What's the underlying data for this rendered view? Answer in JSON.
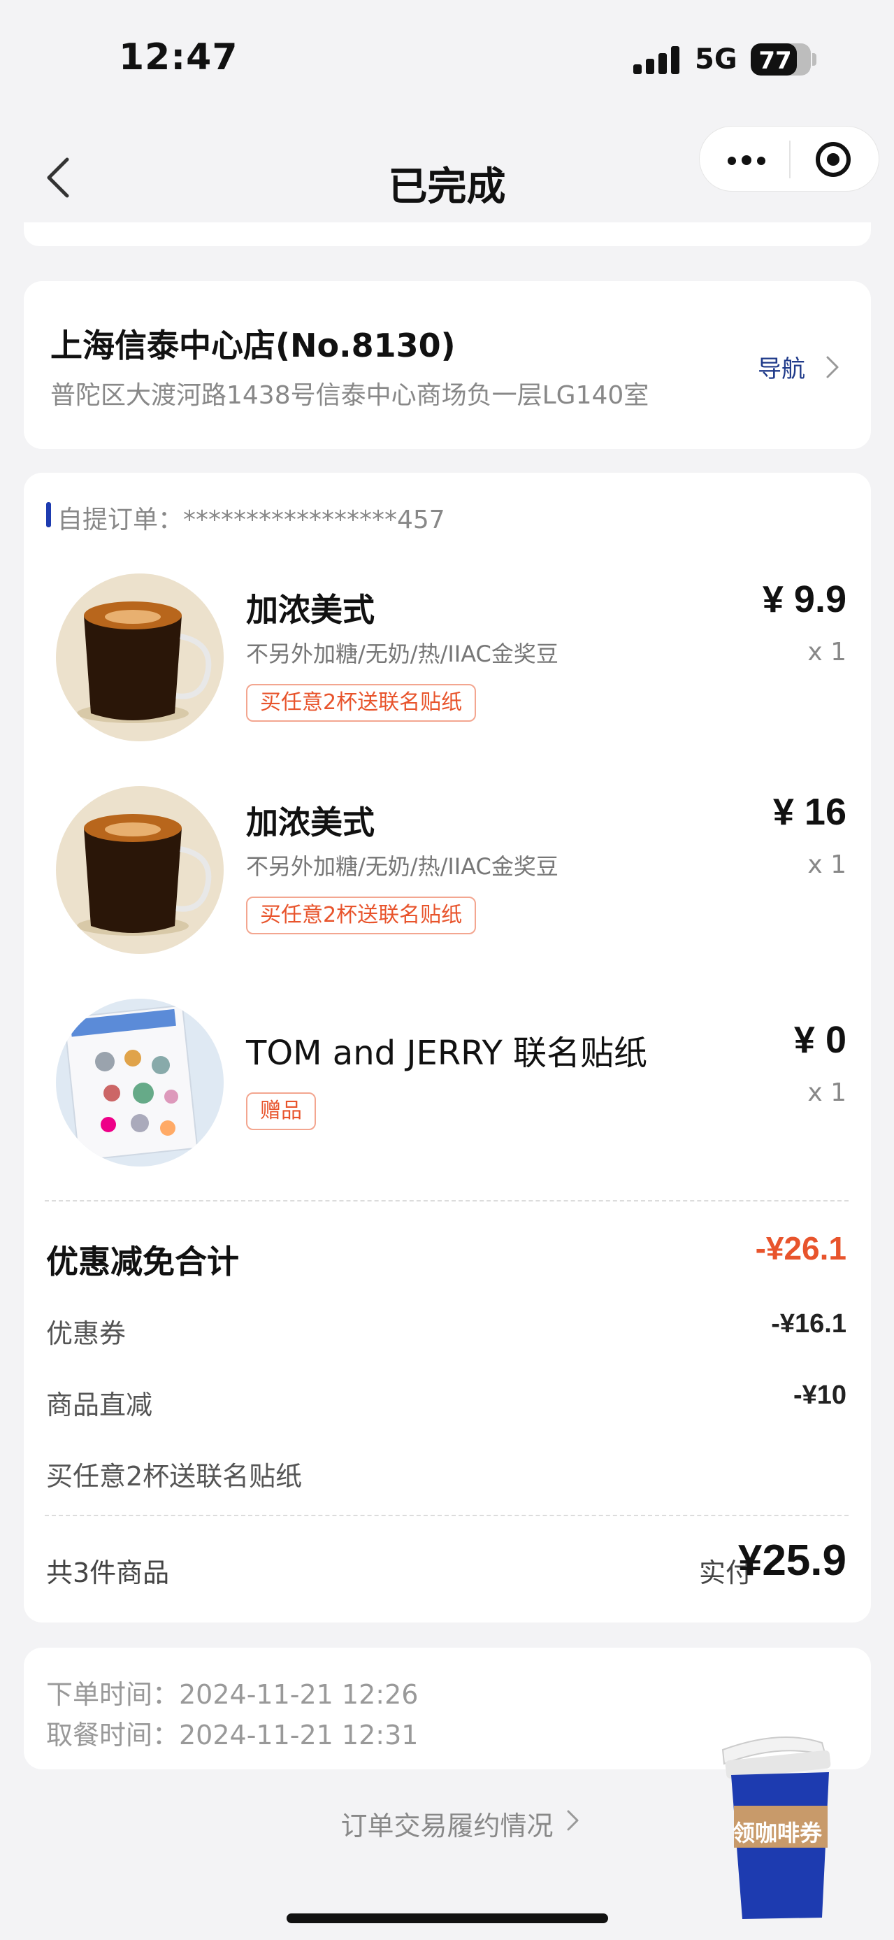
{
  "status_bar": {
    "time": "12:47",
    "network": "5G",
    "battery": "77",
    "battery_level": 0.77
  },
  "nav": {
    "title": "已完成"
  },
  "store": {
    "name": "上海信泰中心店(No.8130)",
    "address": "普陀区大渡河路1438号信泰中心商场负一层LG140室",
    "nav_label": "导航"
  },
  "order": {
    "label": "自提订单：*****************457",
    "items": [
      {
        "name": "加浓美式",
        "spec": "不另外加糖/无奶/热/IIAC金奖豆",
        "tag": "买任意2杯送联名贴纸",
        "price": "¥ 9.9",
        "qty": "x 1"
      },
      {
        "name": "加浓美式",
        "spec": "不另外加糖/无奶/热/IIAC金奖豆",
        "tag": "买任意2杯送联名贴纸",
        "price": "¥ 16",
        "qty": "x 1"
      },
      {
        "name": "TOM and JERRY 联名贴纸",
        "spec": "",
        "tag": "赠品",
        "price": "¥ 0",
        "qty": "x 1"
      }
    ],
    "discount": {
      "title": "优惠减免合计",
      "total": "-¥26.1",
      "rows": [
        {
          "label": "优惠券",
          "value": "-¥16.1"
        },
        {
          "label": "商品直减",
          "value": "-¥10"
        },
        {
          "label": "买任意2杯送联名贴纸",
          "value": ""
        }
      ]
    },
    "count": "共3件商品",
    "paid_label": "实付",
    "paid": "¥25.9"
  },
  "times": {
    "order_time": "下单时间：2024-11-21 12:26",
    "pickup_time": "取餐时间：2024-11-21 12:31"
  },
  "trace_link": "订单交易履约情况",
  "coffee_coupon": "领咖啡券",
  "colors": {
    "accent_red": "#e8542c",
    "nav_blue": "#1f3a8a",
    "brand_blue": "#1d3bb0"
  }
}
